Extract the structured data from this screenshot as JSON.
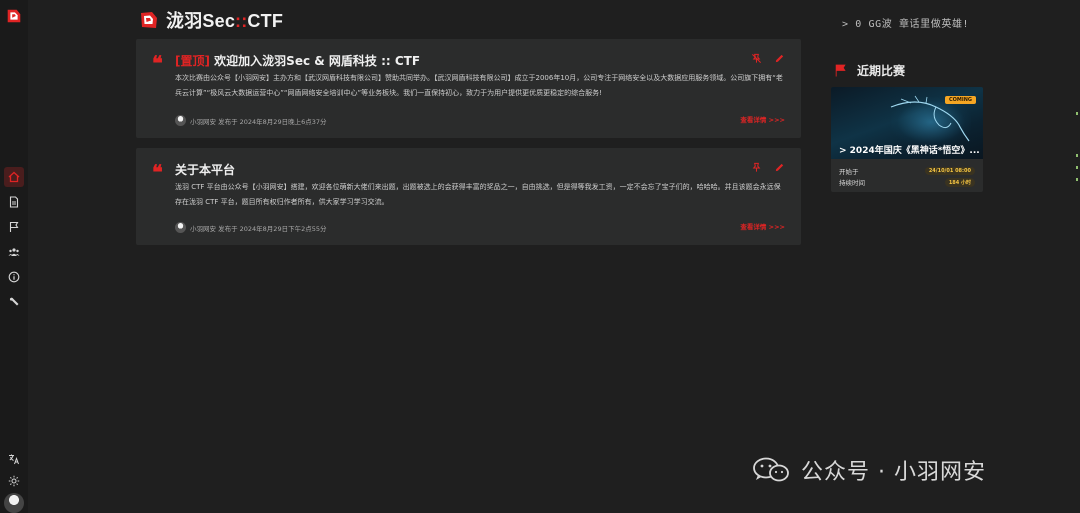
{
  "brand": {
    "title_main": "泷羽Sec",
    "title_sep": "::",
    "title_suffix": "CTF",
    "accent": "#e02424"
  },
  "topbar": {
    "slogan": "> 0 GG波  章话里做英雄!"
  },
  "sidebar": {
    "items": [
      {
        "icon": "home-icon",
        "active": true
      },
      {
        "icon": "document-icon",
        "active": false
      },
      {
        "icon": "flag-icon",
        "active": false
      },
      {
        "icon": "users-icon",
        "active": false
      },
      {
        "icon": "info-icon",
        "active": false
      },
      {
        "icon": "wrench-icon",
        "active": false
      }
    ],
    "bottom": [
      {
        "icon": "translate-icon"
      },
      {
        "icon": "sun-icon"
      }
    ]
  },
  "posts": [
    {
      "pin_tag": "[置顶]",
      "title": "欢迎加入泷羽Sec & 网盾科技 :: CTF",
      "body": "本次比赛由公众号【小羽网安】主办方和【武汉网盾科技有限公司】赞助共同举办。【武汉网盾科技有限公司】成立于2006年10月，公司专注于网络安全以及大数据应用服务领域。公司旗下拥有“老兵云计算”“极风云大数据运营中心”“网盾网络安全培训中心”等业务板块。我们一直保持初心，致力于为用户提供更优质更稳定的综合服务!",
      "meta": "小羽网安 发布于 2024年8月29日晚上6点37分",
      "readmore": "查看详情 >>>"
    },
    {
      "pin_tag": "",
      "title": "关于本平台",
      "body": "泷羽 CTF 平台由公众号【小羽网安】搭建，欢迎各位萌新大佬们来出题，出题被选上的会获得丰富的奖品之一，自由挑选，但是得等我发工资，一定不会忘了宝子们的，哈哈哈。并且该题会永远保存在泷羽 CTF 平台，题目所有权归作者所有，供大家学习学习交流。",
      "meta": "小羽网安 发布于 2024年8月29日下午2点55分",
      "readmore": "查看详情 >>>"
    }
  ],
  "recent": {
    "heading": "近期比赛",
    "competition": {
      "badge": "COMING",
      "name": "> 2024年国庆《黑神话*悟空》...",
      "start_label": "开始于",
      "start_value": "24/10/01 08:00",
      "duration_label": "持续时间",
      "duration_value": "184 小时"
    }
  },
  "watermark": {
    "text": "公众号 · 小羽网安"
  }
}
